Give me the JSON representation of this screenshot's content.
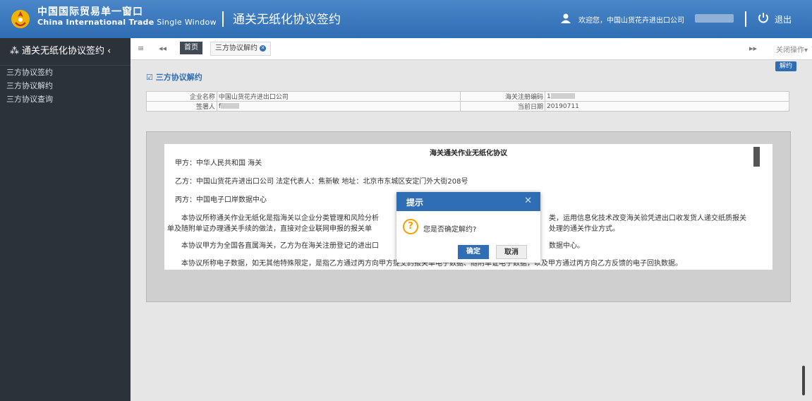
{
  "header": {
    "logo_cn": "中国国际贸易单一窗口",
    "logo_en_main": "China International Trade",
    "logo_en_tail": " Single Window",
    "app_title": "通关无纸化协议签约",
    "welcome_text": "欢迎您，中国山货花卉进出口公司",
    "logout_label": "退出",
    "accent_color": "#2f6db4"
  },
  "sidebar": {
    "title": "通关无纸化协议签约",
    "items": [
      {
        "label": "三方协议签约"
      },
      {
        "label": "三方协议解约"
      },
      {
        "label": "三方协议查询"
      }
    ]
  },
  "tabbar": {
    "home_label": "首页",
    "active_tab_label": "三方协议解约",
    "close_ops_label": "关闭操作▾"
  },
  "content": {
    "cancel_button_label": "解约",
    "section_title": "三方协议解约",
    "info": {
      "company_label": "企业名称",
      "company_value": "中国山货花卉进出口公司",
      "customs_code_label": "海关注册编码",
      "customs_code_value": "1",
      "signer_label": "签署人",
      "signer_value": "f",
      "date_label": "当前日期",
      "date_value": "20190711"
    },
    "agreement": {
      "title": "海关通关作业无纸化协议",
      "party_a": "甲方：中华人民共和国      海关",
      "party_b": "乙方：中国山货花卉进出口公司    法定代表人：焦新敏    地址：北京市东城区安定门外大街208号",
      "party_c": "丙方：中国电子口岸数据中心",
      "para1_left": "本协议所称通关作业无纸化是指海关以企业分类管理和风险分析",
      "para1_right": "类，运用信息化技术改变海关验凭进出口收发货人递交纸质报关",
      "para1b_left": "单及随附单证办理通关手续的做法，直接对企业联网申报的报关单",
      "para1b_right": "处理的通关作业方式。",
      "para2_left": "本协议甲方为全国各直属海关，乙方为在海关注册登记的进出口",
      "para2_right": "数据中心。",
      "para3": "本协议所称电子数据，如无其他特殊限定，是指乙方通过丙方向甲方提交的报关单电子数据、随附单证电子数据，以及甲方通过丙方向乙方反馈的电子回执数据。"
    }
  },
  "dialog": {
    "title": "提示",
    "message": "您是否确定解约?",
    "ok_label": "确定",
    "cancel_label": "取消"
  }
}
